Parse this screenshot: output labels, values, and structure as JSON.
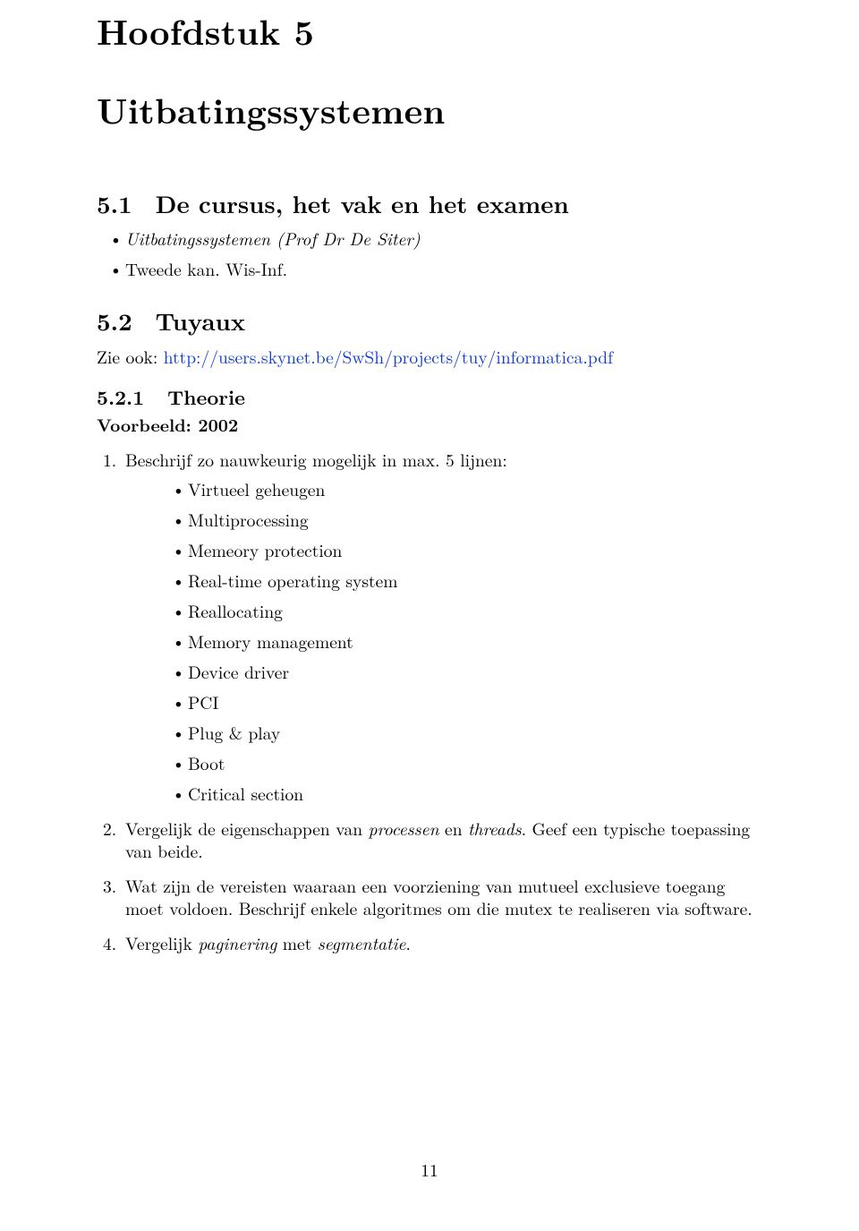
{
  "chapter": {
    "label": "Hoofdstuk 5",
    "title": "Uitbatingssystemen"
  },
  "section51": {
    "number": "5.1",
    "title": "De cursus, het vak en het examen",
    "items": [
      "Uitbatingssystemen (Prof Dr De Siter)",
      "Tweede kan. Wis-Inf."
    ]
  },
  "section52": {
    "number": "5.2",
    "title": "Tuyaux",
    "zie_ook_label": "Zie ook: ",
    "link_text": "http://users.skynet.be/SwSh/projects/tuy/informatica.pdf"
  },
  "subsection521": {
    "number": "5.2.1",
    "title": "Theorie",
    "example_label": "Voorbeeld: 2002",
    "q1": {
      "num": "1.",
      "text": "Beschrijf zo nauwkeurig mogelijk in max. 5 lijnen:",
      "items": [
        "Virtueel geheugen",
        "Multiprocessing",
        "Memeory protection",
        "Real-time operating system",
        "Reallocating",
        "Memory management",
        "Device driver",
        "PCI",
        "Plug & play",
        "Boot",
        "Critical section"
      ]
    },
    "q2": {
      "num": "2.",
      "pre": "Vergelijk de eigenschappen van ",
      "it1": "processen",
      "mid": " en ",
      "it2": "threads",
      "post": ". Geef een typische toepassing van beide."
    },
    "q3": {
      "num": "3.",
      "text": "Wat zijn de vereisten waaraan een voorziening van mutueel exclusieve toegang moet voldoen. Beschrijf enkele algoritmes om die mutex te realiseren via software."
    },
    "q4": {
      "num": "4.",
      "pre": "Vergelijk ",
      "it1": "paginering",
      "mid": " met ",
      "it2": "segmentatie",
      "post": "."
    }
  },
  "page_number": "11"
}
